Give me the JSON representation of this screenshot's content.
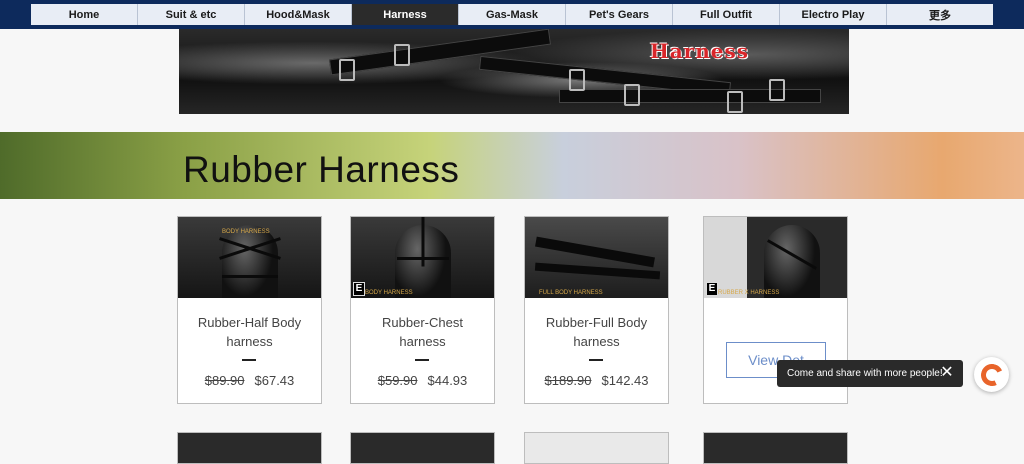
{
  "nav": {
    "items": [
      "Home",
      "Suit & etc",
      "Hood&Mask",
      "Harness",
      "Gas-Mask",
      "Pet's Gears",
      "Full Outfit",
      "Electro Play",
      "更多"
    ],
    "active": "Harness"
  },
  "banner": {
    "title": "Harness"
  },
  "hero": {
    "title": "Rubber Harness"
  },
  "products": [
    {
      "name": "Rubber-Half Body harness",
      "old_price": "$89.90",
      "price": "$67.43",
      "thumb_caption": "BODY HARNESS"
    },
    {
      "name": "Rubber-Chest harness",
      "old_price": "$59.90",
      "price": "$44.93",
      "thumb_caption": "BODY HARNESS"
    },
    {
      "name": "Rubber-Full Body harness",
      "old_price": "$189.90",
      "price": "$142.43",
      "thumb_caption": "FULL BODY HARNESS"
    },
    {
      "view_label": "View Det",
      "thumb_caption": "RUBBER X HARNESS"
    }
  ],
  "toast": {
    "text": "Come and share with more people!"
  },
  "colors": {
    "nav_bg": "#0d2a5c",
    "accent": "#6c8ec9",
    "banner_title": "#d8262a",
    "chat_brand": "#e8642a"
  },
  "icons": {
    "close": "close-icon",
    "chat": "chat-icon",
    "logo": "brand-e-logo"
  }
}
